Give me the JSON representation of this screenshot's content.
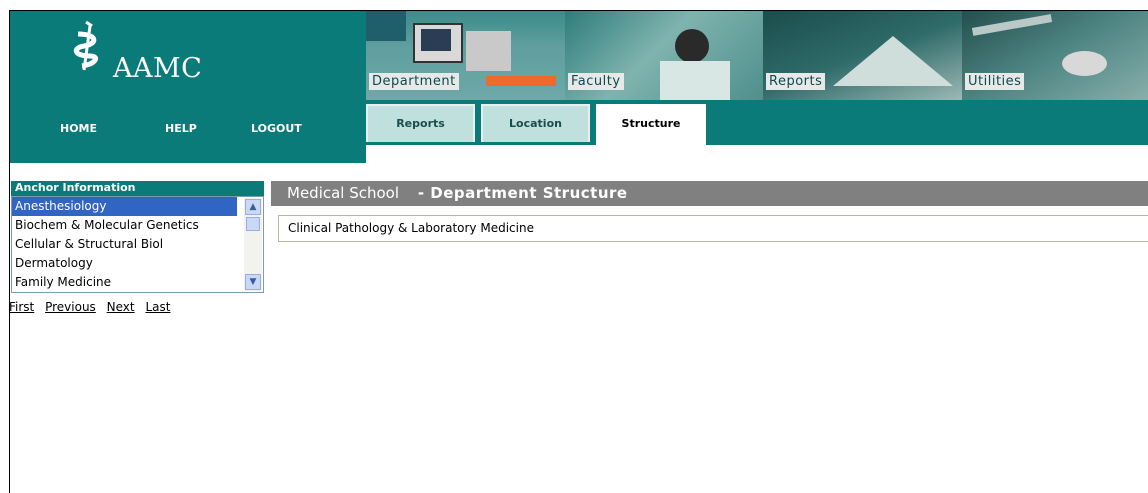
{
  "logo": {
    "text": "AAMC"
  },
  "nav": {
    "home": "HOME",
    "help": "HELP",
    "logout": "LOGOUT"
  },
  "banners": [
    "Department",
    "Faculty",
    "Reports",
    "Utilities"
  ],
  "tabs": [
    {
      "label": "Reports",
      "active": false
    },
    {
      "label": "Location",
      "active": false
    },
    {
      "label": "Structure",
      "active": true
    }
  ],
  "anchor": {
    "title": "Anchor Information",
    "items": [
      "Anesthesiology",
      "Biochem & Molecular Genetics",
      "Cellular & Structural Biol",
      "Dermatology",
      "Family Medicine"
    ],
    "selected": "Anesthesiology"
  },
  "pager": {
    "first": "First",
    "previous": "Previous",
    "next": "Next",
    "last": "Last"
  },
  "structure": {
    "school": "Medical School",
    "separator": "-",
    "title": "Department Structure",
    "department": "Clinical Pathology & Laboratory Medicine"
  },
  "colors": {
    "teal": "#0b7b7a",
    "tab": "#bfe0dc",
    "selection": "#3165c4",
    "header": "#808080"
  }
}
